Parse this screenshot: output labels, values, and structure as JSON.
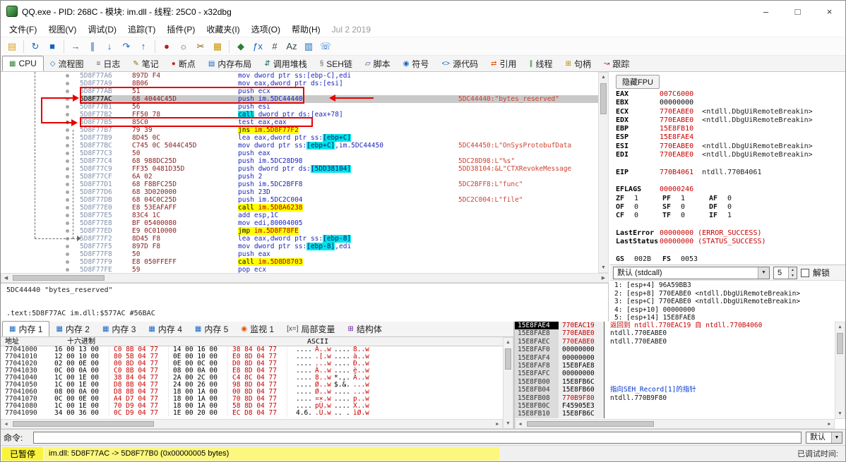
{
  "window": {
    "title": "QQ.exe - PID: 268C - 模块: im.dll - 线程: 25C0 - x32dbg",
    "controls": [
      {
        "id": "minimize",
        "glyph": "–"
      },
      {
        "id": "maximize",
        "glyph": "□"
      },
      {
        "id": "close",
        "glyph": "×"
      }
    ]
  },
  "menu": {
    "items": [
      "文件(F)",
      "视图(V)",
      "调试(D)",
      "追踪(T)",
      "插件(P)",
      "收藏夹(I)",
      "选项(O)",
      "帮助(H)"
    ],
    "date": "Jul 2 2019"
  },
  "toolbar": {
    "buttons": [
      {
        "name": "open-file",
        "glyph": "▤",
        "color": "#d9a11c"
      },
      {
        "name": "restart",
        "glyph": "↻",
        "color": "#1565c0",
        "sep": true
      },
      {
        "name": "stop-debug",
        "glyph": "■",
        "color": "#1565c0"
      },
      {
        "name": "run",
        "glyph": "→",
        "color": "#1565c0",
        "sep": true
      },
      {
        "name": "pause",
        "glyph": "∥",
        "color": "#1565c0"
      },
      {
        "name": "step-into",
        "glyph": "↓",
        "color": "#1565c0"
      },
      {
        "name": "step-over",
        "glyph": "↷",
        "color": "#1565c0"
      },
      {
        "name": "execute-till-return",
        "glyph": "↑",
        "color": "#1565c0"
      },
      {
        "name": "run-trace",
        "glyph": "●",
        "color": "#b71c1c",
        "sep": true
      },
      {
        "name": "settings",
        "glyph": "☼",
        "color": "#616161"
      },
      {
        "name": "strip-scissors",
        "glyph": "✂",
        "color": "#7b5e00"
      },
      {
        "name": "scratchpad",
        "glyph": "▦",
        "color": "#c99700"
      },
      {
        "name": "plugins",
        "glyph": "◆",
        "color": "#2e7d32",
        "sep": true
      },
      {
        "name": "favourites-fx",
        "glyph": "ƒx",
        "color": "#1565c0"
      },
      {
        "name": "calculator",
        "glyph": "#",
        "color": "#37474f"
      },
      {
        "name": "assembler-az",
        "glyph": "Az",
        "color": "#37474f"
      },
      {
        "name": "cpu-window",
        "glyph": "▥",
        "color": "#1565c0"
      },
      {
        "name": "report-bug",
        "glyph": "☏",
        "color": "#1565c0"
      }
    ]
  },
  "tabs": {
    "items": [
      {
        "id": "cpu",
        "label": "CPU",
        "glyph": "▦",
        "color": "#2e7d32",
        "selected": true
      },
      {
        "id": "graph",
        "label": "流程图",
        "glyph": "◇",
        "color": "#1565c0"
      },
      {
        "id": "log",
        "label": "日志",
        "glyph": "≡",
        "color": "#616161"
      },
      {
        "id": "notes",
        "label": "笔记",
        "glyph": "✎",
        "color": "#8d6e00"
      },
      {
        "id": "breakpoints",
        "label": "断点",
        "glyph": "●",
        "color": "#c62828"
      },
      {
        "id": "memory-map",
        "label": "内存布局",
        "glyph": "▤",
        "color": "#1565c0"
      },
      {
        "id": "call-stack",
        "label": "调用堆栈",
        "glyph": "⇵",
        "color": "#00695c"
      },
      {
        "id": "seh",
        "label": "SEH链",
        "glyph": "§",
        "color": "#616161"
      },
      {
        "id": "script",
        "label": "脚本",
        "glyph": "▱",
        "color": "#6a1b9a"
      },
      {
        "id": "symbols",
        "label": "符号",
        "glyph": "◉",
        "color": "#1565c0"
      },
      {
        "id": "source",
        "label": "源代码",
        "glyph": "<>",
        "color": "#1565c0"
      },
      {
        "id": "references",
        "label": "引用",
        "glyph": "⇄",
        "color": "#e65100"
      },
      {
        "id": "threads",
        "label": "线程",
        "glyph": "∥",
        "color": "#2e7d32"
      },
      {
        "id": "handles",
        "label": "句柄",
        "glyph": "⊞",
        "color": "#b8860b"
      },
      {
        "id": "trace",
        "label": "跟踪",
        "glyph": "↝",
        "color": "#c62828"
      }
    ]
  },
  "disasm": {
    "rows": [
      {
        "a": "5D8F77A6",
        "b": "897D F4",
        "i": [
          {
            "t": "mov dword ptr ss:[ebp-C],edi"
          }
        ]
      },
      {
        "a": "5D8F77A9",
        "b": "8B06",
        "i": [
          {
            "t": "mov eax,dword ptr ds:[esi]"
          }
        ]
      },
      {
        "a": "5D8F77AB",
        "b": "51",
        "i": [
          {
            "t": "push ecx"
          }
        ]
      },
      {
        "a": "5D8F77AC",
        "b": "68 4044C45D",
        "i": [
          {
            "t": "push im.5DC44440"
          }
        ],
        "sel": true,
        "c": "5DC44440:\"bytes_reserved\""
      },
      {
        "a": "5D8F77B1",
        "b": "56",
        "i": [
          {
            "t": "push esi"
          }
        ]
      },
      {
        "a": "5D8F77B2",
        "b": "FF50 78",
        "i": [
          {
            "t": "call",
            "k": "hc"
          },
          {
            "t": " dword ptr ds:[eax+78]"
          }
        ]
      },
      {
        "a": "5D8F77B5",
        "b": "85C0",
        "i": [
          {
            "t": "test eax,eax"
          }
        ],
        "dot": "green"
      },
      {
        "a": "5D8F77B7",
        "b": "79 39",
        "i": [
          {
            "t": "jns ",
            "k": "hy"
          },
          {
            "t": "im.5D8F77F2",
            "k": "hyr"
          }
        ]
      },
      {
        "a": "5D8F77B9",
        "b": "8D45 0C",
        "i": [
          {
            "t": "lea eax,dword ptr ss:"
          },
          {
            "t": "[ebp+C]",
            "k": "hc"
          }
        ]
      },
      {
        "a": "5D8F77BC",
        "b": "C745 0C 5044C45D",
        "i": [
          {
            "t": "mov dword ptr ss:"
          },
          {
            "t": "[ebp+C]",
            "k": "hc"
          },
          {
            "t": ",im.5DC44450"
          }
        ],
        "c": "5DC44450:L\"OnSysProtobufData"
      },
      {
        "a": "5D8F77C3",
        "b": "50",
        "i": [
          {
            "t": "push eax"
          }
        ]
      },
      {
        "a": "5D8F77C4",
        "b": "68 988DC25D",
        "i": [
          {
            "t": "push im.5DC28D98"
          }
        ],
        "c": "5DC28D98:L\"%s\""
      },
      {
        "a": "5D8F77C9",
        "b": "FF35 0481D35D",
        "i": [
          {
            "t": "push dword ptr ds:"
          },
          {
            "t": "[5DD38104]",
            "k": "hc"
          }
        ],
        "c": "5DD38104:&L\"CTXRevokeMessage"
      },
      {
        "a": "5D8F77CF",
        "b": "6A 02",
        "i": [
          {
            "t": "push 2"
          }
        ]
      },
      {
        "a": "5D8F77D1",
        "b": "68 F8BFC25D",
        "i": [
          {
            "t": "push im.5DC2BFF8"
          }
        ],
        "c": "5DC2BFF8:L\"func\""
      },
      {
        "a": "5D8F77D6",
        "b": "68 3D020000",
        "i": [
          {
            "t": "push 23D"
          }
        ]
      },
      {
        "a": "5D8F77DB",
        "b": "68 04C0C25D",
        "i": [
          {
            "t": "push im.5DC2C004"
          }
        ],
        "c": "5DC2C004:L\"file\""
      },
      {
        "a": "5D8F77E0",
        "b": "E8 53EAFAFF",
        "i": [
          {
            "t": "call ",
            "k": "hy"
          },
          {
            "t": "im.5D8A6238",
            "k": "hyr"
          }
        ]
      },
      {
        "a": "5D8F77E5",
        "b": "83C4 1C",
        "i": [
          {
            "t": "add esp,1C"
          }
        ]
      },
      {
        "a": "5D8F77E8",
        "b": "BF 05400080",
        "i": [
          {
            "t": "mov edi,80004005"
          }
        ]
      },
      {
        "a": "5D8F77ED",
        "b": "E9 0C010000",
        "i": [
          {
            "t": "jmp ",
            "k": "hy"
          },
          {
            "t": "im.5D8F78FE",
            "k": "hyr"
          }
        ]
      },
      {
        "a": "5D8F77F2",
        "b": "8D45 F8",
        "i": [
          {
            "t": "lea eax,dword ptr ss:"
          },
          {
            "t": "[ebp-8]",
            "k": "hc"
          }
        ]
      },
      {
        "a": "5D8F77F5",
        "b": "897D F8",
        "i": [
          {
            "t": "mov dword ptr ss:"
          },
          {
            "t": "[ebp-8]",
            "k": "hc"
          },
          {
            "t": ",edi"
          }
        ]
      },
      {
        "a": "5D8F77F8",
        "b": "50",
        "i": [
          {
            "t": "push eax"
          }
        ]
      },
      {
        "a": "5D8F77F9",
        "b": "E8 050FFEFF",
        "i": [
          {
            "t": "call ",
            "k": "hy"
          },
          {
            "t": "im.5D8D8703",
            "k": "hyr"
          }
        ]
      },
      {
        "a": "5D8F77FE",
        "b": "59",
        "i": [
          {
            "t": "pop ecx"
          }
        ]
      }
    ],
    "info1": "5DC44440 \"bytes_reserved\"",
    "info2": ".text:5D8F77AC im.dll:$577AC #56BAC"
  },
  "registers": {
    "hide_fpu_label": "隐藏FPU",
    "lines": [
      {
        "t": "reg",
        "n": "EAX",
        "v": "007C6000",
        "red": true
      },
      {
        "t": "reg",
        "n": "EBX",
        "v": "00000000"
      },
      {
        "t": "reg",
        "n": "ECX",
        "v": "770EABE0",
        "red": true,
        "note": "<ntdll.DbgUiRemoteBreakin>"
      },
      {
        "t": "reg",
        "n": "EDX",
        "v": "770EABE0",
        "red": true,
        "note": "<ntdll.DbgUiRemoteBreakin>"
      },
      {
        "t": "reg",
        "n": "EBP",
        "v": "15E8FB10",
        "red": true
      },
      {
        "t": "reg",
        "n": "ESP",
        "v": "15E8FAE4",
        "red": true
      },
      {
        "t": "reg",
        "n": "ESI",
        "v": "770EABE0",
        "red": true,
        "note": "<ntdll.DbgUiRemoteBreakin>"
      },
      {
        "t": "reg",
        "n": "EDI",
        "v": "770EABE0",
        "red": true,
        "note": "<ntdll.DbgUiRemoteBreakin>"
      },
      {
        "t": "blank"
      },
      {
        "t": "reg",
        "n": "EIP",
        "v": "770B4061",
        "red": true,
        "note": "ntdll.770B4061"
      },
      {
        "t": "blank"
      },
      {
        "t": "reg",
        "n": "EFLAGS",
        "v": "00000246",
        "red": true
      },
      {
        "t": "flags",
        "f": [
          [
            "ZF",
            "1"
          ],
          [
            "PF",
            "1"
          ],
          [
            "AF",
            "0"
          ]
        ]
      },
      {
        "t": "flags",
        "f": [
          [
            "OF",
            "0"
          ],
          [
            "SF",
            "0"
          ],
          [
            "DF",
            "0"
          ]
        ]
      },
      {
        "t": "flags",
        "f": [
          [
            "CF",
            "0"
          ],
          [
            "TF",
            "0"
          ],
          [
            "IF",
            "1"
          ]
        ]
      },
      {
        "t": "blank"
      },
      {
        "t": "reg",
        "n": "LastError",
        "v": "00000000 (ERROR_SUCCESS)",
        "red": true
      },
      {
        "t": "reg",
        "n": "LastStatus",
        "v": "00000000 (STATUS_SUCCESS)",
        "red": true
      },
      {
        "t": "blank"
      },
      {
        "t": "flags",
        "f": [
          [
            "GS",
            "002B"
          ],
          [
            "FS",
            "0053"
          ]
        ]
      }
    ]
  },
  "callconv": {
    "selected": "默认 (stdcall)",
    "count": "5",
    "unlock_label": "解锁",
    "args": [
      "1: [esp+4] 96A59BB3",
      "2: [esp+8] 770EABE0 <ntdll.DbgUiRemoteBreakin>",
      "3: [esp+C] 770EABE0 <ntdll.DbgUiRemoteBreakin>",
      "4: [esp+10] 00000000",
      "5: [esp+14] 15E8FAE8"
    ]
  },
  "bottom_tabs": {
    "items": [
      {
        "id": "dump1",
        "label": "内存 1",
        "glyph": "▦",
        "color": "#1565c0",
        "selected": true
      },
      {
        "id": "dump2",
        "label": "内存 2",
        "glyph": "▦",
        "color": "#1565c0"
      },
      {
        "id": "dump3",
        "label": "内存 3",
        "glyph": "▦",
        "color": "#1565c0"
      },
      {
        "id": "dump4",
        "label": "内存 4",
        "glyph": "▦",
        "color": "#1565c0"
      },
      {
        "id": "dump5",
        "label": "内存 5",
        "glyph": "▦",
        "color": "#1565c0"
      },
      {
        "id": "watch1",
        "label": "监视 1",
        "glyph": "◉",
        "color": "#e65100"
      },
      {
        "id": "locals",
        "label": "局部变量",
        "glyph": "[x=]",
        "color": "#37474f"
      },
      {
        "id": "struct",
        "label": "结构体",
        "glyph": "⊞",
        "color": "#6a1b9a"
      }
    ]
  },
  "dump": {
    "headers": {
      "addr": "地址",
      "hex": "十六进制",
      "ascii": "ASCII"
    },
    "rows": [
      {
        "addr": "77041000",
        "g": [
          "16 00 13 00",
          "C0 8B 04 77",
          "14 00 16 00",
          "38 84 04 77"
        ],
        "asc": [
          "....",
          "À..w",
          "....",
          "8..w"
        ]
      },
      {
        "addr": "77041010",
        "g": [
          "12 00 10 00",
          "80 5B 04 77",
          "0E 00 10 00",
          "E0 8D 04 77"
        ],
        "asc": [
          "....",
          ".[.w",
          "....",
          "à..w"
        ]
      },
      {
        "addr": "77041020",
        "g": [
          "02 00 0E 00",
          "00 8D 04 77",
          "0E 00 0C 00",
          "D0 8D 04 77"
        ],
        "asc": [
          "....",
          "...w",
          "....",
          "Ð..w"
        ]
      },
      {
        "addr": "77041030",
        "g": [
          "0C 00 0A 00",
          "C0 8B 04 77",
          "08 00 0A 00",
          "E8 8D 04 77"
        ],
        "asc": [
          "....",
          "À..w",
          "....",
          "è..w"
        ]
      },
      {
        "addr": "77041040",
        "g": [
          "1C 00 1E 00",
          "38 84 04 77",
          "2A 00 2C 00",
          "C4 8C 04 77"
        ],
        "asc": [
          "....",
          "8..w",
          "*.,.",
          "Ä..w"
        ]
      },
      {
        "addr": "77041050",
        "g": [
          "1C 00 1E 00",
          "D8 8B 04 77",
          "24 00 26 00",
          "98 8D 04 77"
        ],
        "asc": [
          "....",
          "Ø..w",
          "$.&.",
          "...w"
        ]
      },
      {
        "addr": "77041060",
        "g": [
          "08 00 0A 00",
          "D8 8B 04 77",
          "18 00 1A 00",
          "00 8D 04 77"
        ],
        "asc": [
          "....",
          "Ø..w",
          "....",
          "...w"
        ]
      },
      {
        "addr": "77041070",
        "g": [
          "0C 00 0E 00",
          "A4 D7 04 77",
          "18 00 1A 00",
          "70 8D 04 77"
        ],
        "asc": [
          "....",
          "¤×.w",
          "....",
          "p..w"
        ]
      },
      {
        "addr": "77041080",
        "g": [
          "1C 00 1E 00",
          "70 D9 04 77",
          "18 00 1A 00",
          "58 8D 04 77"
        ],
        "asc": [
          "....",
          "pÙ.w",
          "....",
          "X..w"
        ]
      },
      {
        "addr": "77041090",
        "g": [
          "34 00 36 00",
          "0C D9 04 77",
          "1E 00 20 00",
          "EC D8 04 77"
        ],
        "asc": [
          "4.6.",
          ".Ù.w",
          ".. .",
          "ìØ.w"
        ]
      }
    ]
  },
  "stack": {
    "rows": [
      {
        "a": "15E8FAE4",
        "v": "770EAC19",
        "vr": true,
        "sel": true,
        "c": "返回到 ntdll.770EAC19 自 ntdll.770B4060",
        "cc": "red"
      },
      {
        "a": "15E8FAE8",
        "v": "770EABE0",
        "vr": true,
        "c": "ntdll.770EABE0"
      },
      {
        "a": "15E8FAEC",
        "v": "770EABE0",
        "vr": true,
        "c": "ntdll.770EABE0"
      },
      {
        "a": "15E8FAF0",
        "v": "00000000"
      },
      {
        "a": "15E8FAF4",
        "v": "00000000"
      },
      {
        "a": "15E8FAF8",
        "v": "15E8FAE8"
      },
      {
        "a": "15E8FAFC",
        "v": "00000000"
      },
      {
        "a": "15E8FB00",
        "v": "15E8FB6C"
      },
      {
        "a": "15E8FB04",
        "v": "15E8FB60",
        "c": "指向SEH_Record[1]的指针",
        "cc": "blue"
      },
      {
        "a": "15E8FB08",
        "v": "770B9F80",
        "vr": true,
        "c": "ntdll.770B9F80"
      },
      {
        "a": "15E8FB0C",
        "v": "F45905E3"
      },
      {
        "a": "15E8FB10",
        "v": "15E8FB6C"
      }
    ]
  },
  "command": {
    "label": "命令:",
    "value": "",
    "profile": "默认"
  },
  "status": {
    "state": "已暂停",
    "message": "im.dll: 5D8F77AC -> 5D8F77B0 (0x00000005 bytes)",
    "right": "已调试时间:"
  }
}
